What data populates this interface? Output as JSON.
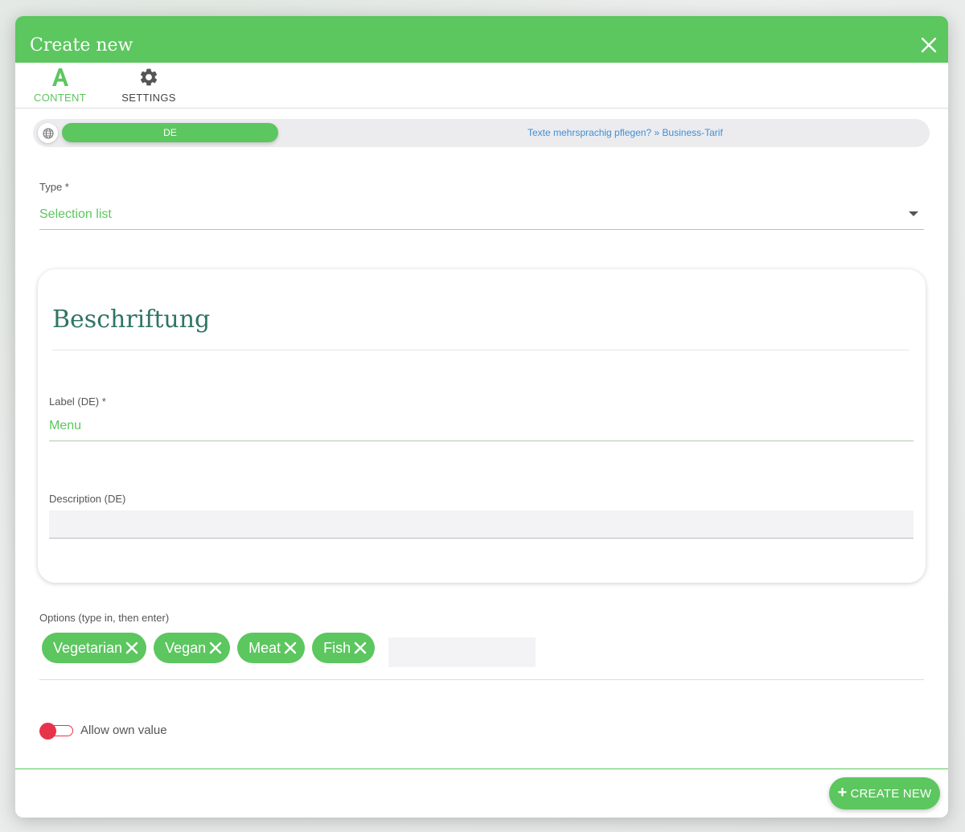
{
  "modal": {
    "title": "Create new"
  },
  "tabs": [
    {
      "label": "CONTENT",
      "icon": "text-a-icon",
      "active": true
    },
    {
      "label": "SETTINGS",
      "icon": "gear-icon",
      "active": false
    }
  ],
  "language_bar": {
    "icon": "globe-icon",
    "active_language": "DE",
    "upsell_link": "Texte mehrsprachig pflegen? » Business-Tarif"
  },
  "type_field": {
    "label": "Type *",
    "value": "Selection list"
  },
  "card": {
    "title": "Beschriftung",
    "label_field": {
      "label": "Label (DE) *",
      "value": "Menu"
    },
    "description_field": {
      "label": "Description (DE)",
      "value": ""
    }
  },
  "options": {
    "label": "Options (type in, then enter)",
    "chips": [
      "Vegetarian",
      "Vegan",
      "Meat",
      "Fish"
    ],
    "input_value": ""
  },
  "allow_own_value": {
    "label": "Allow own value",
    "enabled": false
  },
  "footer": {
    "create_button": "CREATE NEW"
  },
  "colors": {
    "primary": "#5cc65f",
    "heading": "#2f7565",
    "link": "#3d8fd8",
    "toggle_off": "#e8344a"
  }
}
